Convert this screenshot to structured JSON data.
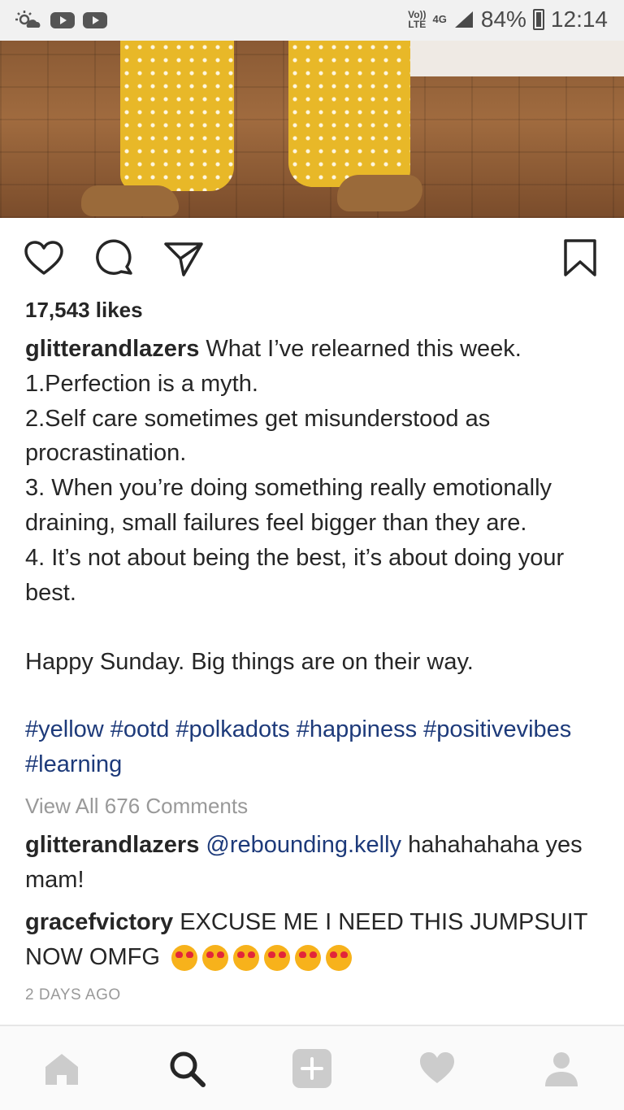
{
  "status_bar": {
    "volte_top": "Vo))",
    "volte_bottom": "LTE",
    "network": "4G",
    "battery": "84%",
    "time": "12:14"
  },
  "post": {
    "likes": "17,543 likes",
    "author": "glitterandlazers",
    "caption": " What I’ve relearned this week.\n1.Perfection is a myth.\n2.Self care sometimes get misunderstood as procrastination.\n3. When you’re doing something really emotionally draining, small failures feel bigger than they are.\n4. It’s not about being the best, it’s about doing your best.\n\nHappy Sunday. Big things are on their way.",
    "hashtags": "#yellow #ootd #polkadots #happiness #positivevibes #learning",
    "view_comments": "View All 676 Comments",
    "comments": [
      {
        "user": "glitterandlazers",
        "mention": "@rebounding.kelly",
        "text": " hahahahaha yes mam!"
      },
      {
        "user": "gracefvictory",
        "text": " EXCUSE ME I NEED THIS JUMPSUIT NOW OMFG"
      }
    ],
    "timestamp": "2 DAYS AGO"
  },
  "icons": {
    "like": "heart-outline-icon",
    "comment": "comment-bubble-icon",
    "share": "paper-plane-icon",
    "save": "bookmark-icon"
  },
  "nav": [
    "home-icon",
    "search-icon",
    "add-post-icon",
    "activity-heart-icon",
    "profile-icon"
  ],
  "colors": {
    "text": "#262626",
    "link": "#1d3a7a",
    "muted": "#999999",
    "nav_inactive": "#cccccc",
    "nav_active": "#262626"
  }
}
